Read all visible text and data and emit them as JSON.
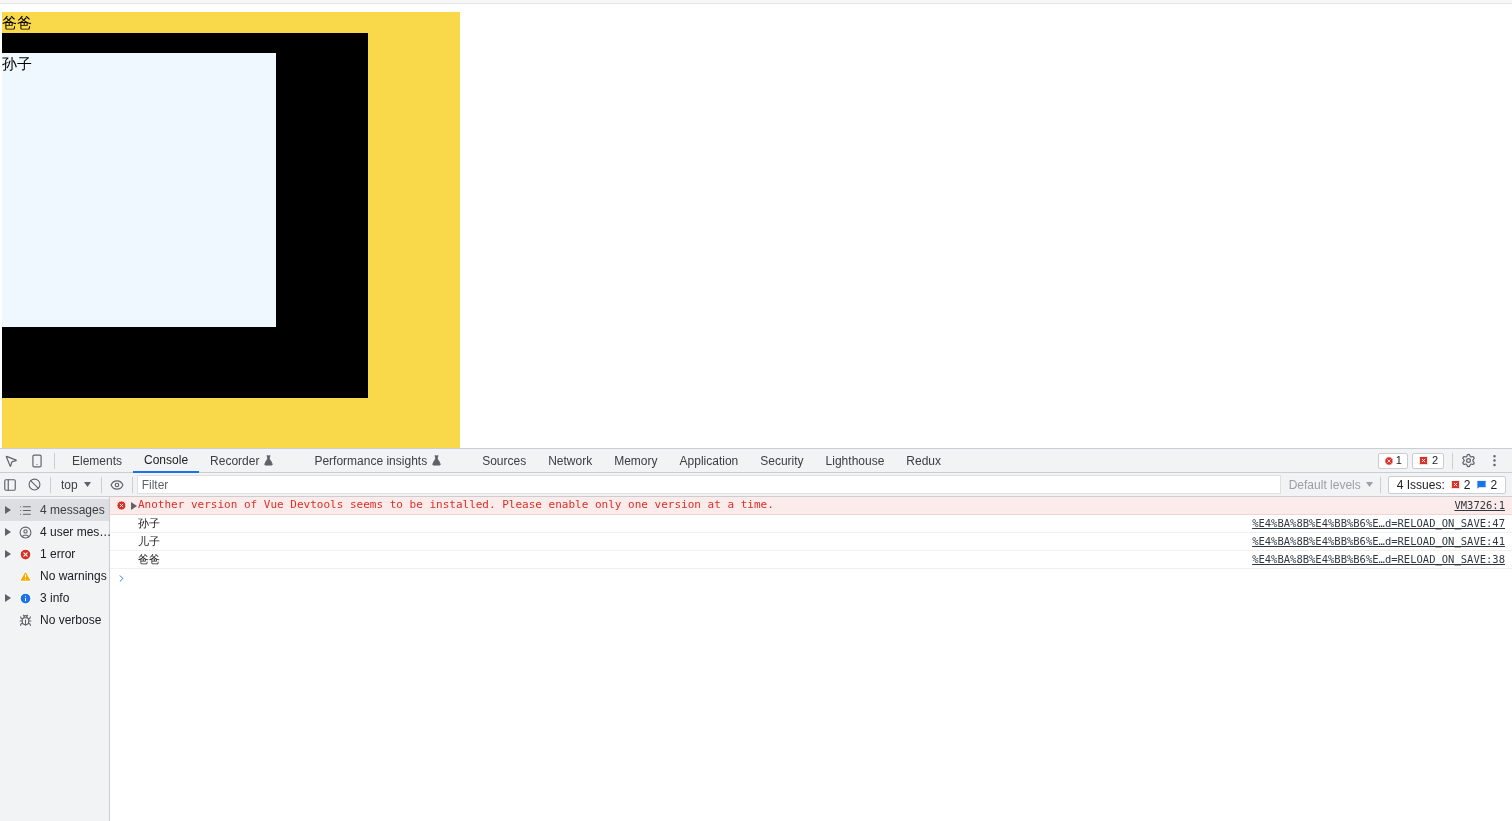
{
  "page": {
    "parent_label": "爸爸",
    "child_label": "孙子"
  },
  "devtools": {
    "tabs": [
      {
        "label": "Elements",
        "selected": false,
        "experimental": false
      },
      {
        "label": "Console",
        "selected": true,
        "experimental": false
      },
      {
        "label": "Recorder",
        "selected": false,
        "experimental": true
      },
      {
        "label": "Performance insights",
        "selected": false,
        "experimental": true
      },
      {
        "label": "Sources",
        "selected": false,
        "experimental": false
      },
      {
        "label": "Network",
        "selected": false,
        "experimental": false
      },
      {
        "label": "Memory",
        "selected": false,
        "experimental": false
      },
      {
        "label": "Application",
        "selected": false,
        "experimental": false
      },
      {
        "label": "Security",
        "selected": false,
        "experimental": false
      },
      {
        "label": "Lighthouse",
        "selected": false,
        "experimental": false
      },
      {
        "label": "Redux",
        "selected": false,
        "experimental": false
      }
    ],
    "error_count": "1",
    "issue_count": "2",
    "toolbar": {
      "context": "top",
      "filter_placeholder": "Filter",
      "levels": "Default levels",
      "issues_label": "4 Issues:",
      "issue_errors": "2",
      "issue_info": "2"
    },
    "sidebar": [
      {
        "kind": "list",
        "label": "4 messages",
        "expandable": true,
        "selected": true
      },
      {
        "kind": "user",
        "label": "4 user mes…",
        "expandable": true,
        "selected": false
      },
      {
        "kind": "error",
        "label": "1 error",
        "expandable": true,
        "selected": false
      },
      {
        "kind": "warning",
        "label": "No warnings",
        "expandable": false,
        "selected": false
      },
      {
        "kind": "info",
        "label": "3 info",
        "expandable": true,
        "selected": false
      },
      {
        "kind": "verbose",
        "label": "No verbose",
        "expandable": false,
        "selected": false
      }
    ],
    "messages": [
      {
        "kind": "error",
        "text": "Another version of Vue Devtools seems to be installed. Please enable only one version at a time.",
        "source": "VM3726:1"
      },
      {
        "kind": "log",
        "text": "孙子",
        "source": "%E4%BA%8B%E4%BB%B6%E…d=RELOAD_ON_SAVE:47"
      },
      {
        "kind": "log",
        "text": "儿子",
        "source": "%E4%BA%8B%E4%BB%B6%E…d=RELOAD_ON_SAVE:41"
      },
      {
        "kind": "log",
        "text": "爸爸",
        "source": "%E4%BA%8B%E4%BB%B6%E…d=RELOAD_ON_SAVE:38"
      }
    ]
  }
}
